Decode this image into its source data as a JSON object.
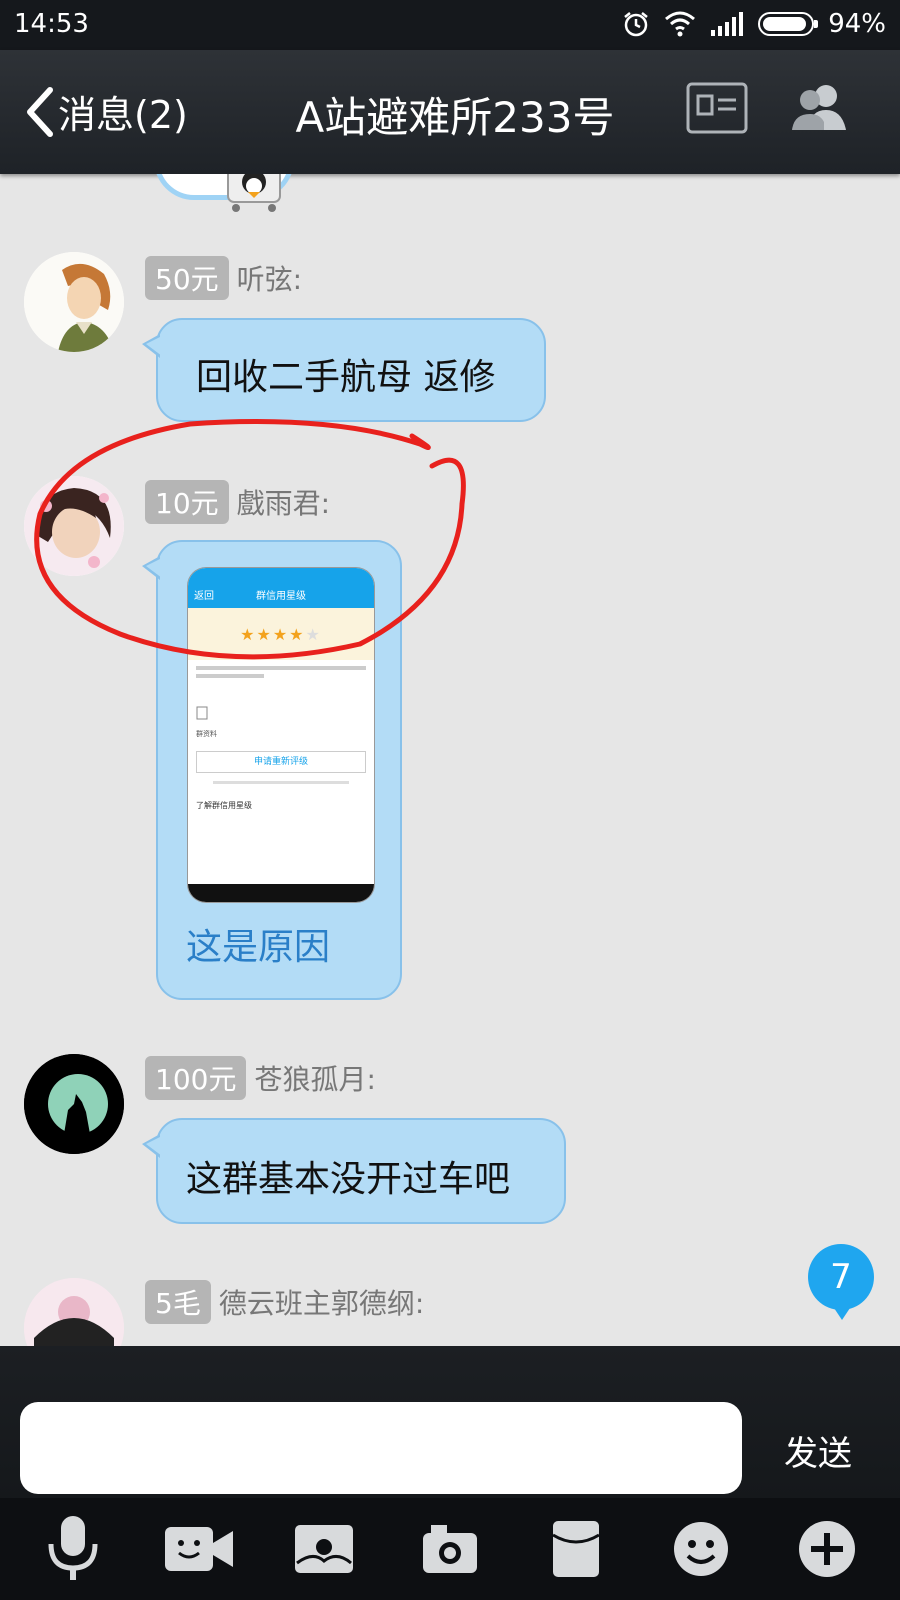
{
  "status_bar": {
    "time": "14:53",
    "battery": "94%",
    "battery_level": 0.94
  },
  "header": {
    "back_label": "消息(2)",
    "title": "A站避难所233号"
  },
  "messages": [
    {
      "badge": "50元",
      "name": "听弦:",
      "text": "回收二手航母 返修"
    },
    {
      "badge": "10元",
      "name": "戲雨君:",
      "caption": "这是原因",
      "screenshot": {
        "back": "返回",
        "title": "群信用星级",
        "button": "申请重新评级",
        "link": "了解群信用星级",
        "file": "群资料"
      }
    },
    {
      "badge": "100元",
      "name": "苍狼孤月:",
      "text": "这群基本没开过车吧"
    },
    {
      "badge": "5毛",
      "name": "德云班主郭德纲:"
    }
  ],
  "unread_count": "7",
  "input": {
    "placeholder": "",
    "send_label": "发送"
  },
  "toolbar": [
    "microphone-icon",
    "video-call-icon",
    "photo-icon",
    "camera-icon",
    "red-packet-icon",
    "emoji-icon",
    "plus-icon"
  ],
  "colors": {
    "bubble": "#b3dcf6",
    "bubble_border": "#88c1ea",
    "badge": "#b5b5b5",
    "unread": "#1fa6ef",
    "annotation": "#e8211d"
  }
}
